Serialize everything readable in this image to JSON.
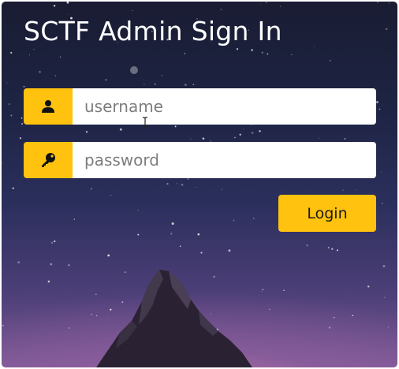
{
  "title": "SCTF Admin Sign In",
  "form": {
    "username": {
      "value": "",
      "placeholder": "username",
      "icon": "user-icon"
    },
    "password": {
      "value": "",
      "placeholder": "password",
      "icon": "key-icon"
    },
    "login_label": "Login"
  },
  "colors": {
    "accent": "#ffc20e",
    "title_text": "#ffffff",
    "input_background": "#ffffff"
  }
}
